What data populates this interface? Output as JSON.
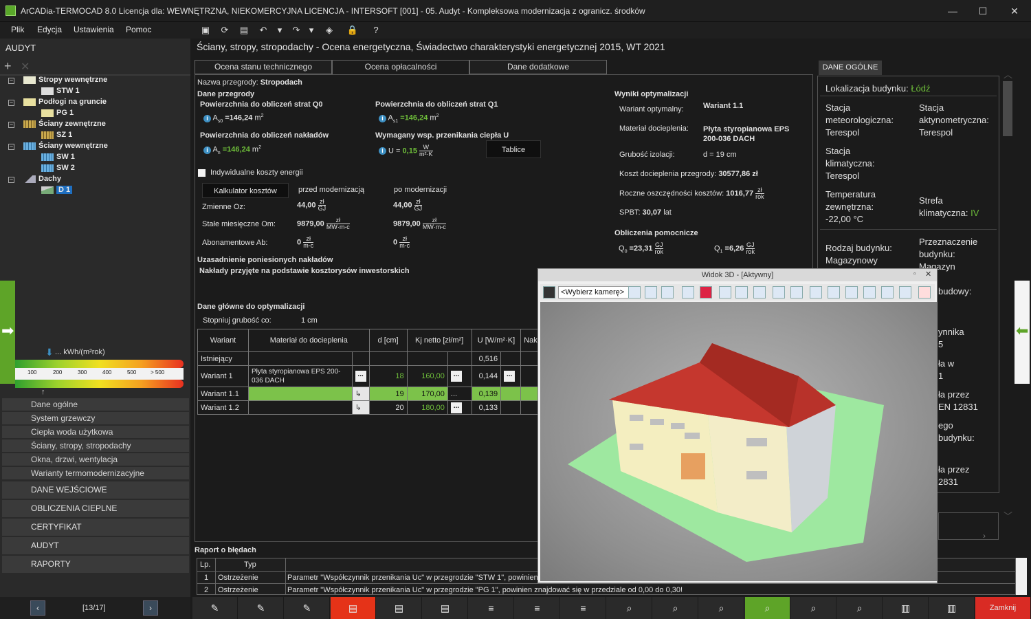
{
  "window": {
    "title": "ArCADia-TERMOCAD 8.0 Licencja dla: WEWNĘTRZNA, NIEKOMERCYJNA LICENCJA - INTERSOFT [001] - 05. Audyt - Kompleksowa modernizacja z ogranicz. środków"
  },
  "menu": [
    "Plik",
    "Edycja",
    "Ustawienia",
    "Pomoc"
  ],
  "left": {
    "title": "AUDYT",
    "tree": [
      {
        "label": "Stropy wewnętrzne",
        "child": "STW 1"
      },
      {
        "label": "Podłogi na gruncie",
        "child": "PG 1"
      },
      {
        "label": "Ściany zewnętrzne",
        "child": "SZ 1"
      },
      {
        "label": "Ściany wewnętrzne",
        "child": "SW 1",
        "child2": "SW 2"
      },
      {
        "label": "Dachy",
        "child": "D 1"
      }
    ],
    "energy_label": "... kWh/(m²rok)",
    "scale": [
      "100",
      "200",
      "300",
      "400",
      "500",
      "> 500"
    ],
    "nav": [
      "Dane ogólne",
      "System grzewczy",
      "Ciepła woda użytkowa",
      "Ściany, stropy, stropodachy",
      "Okna, drzwi, wentylacja",
      "Warianty termomodernizacyjne"
    ],
    "bignav": [
      "DANE WEJŚCIOWE",
      "OBLICZENIA CIEPLNE",
      "CERTYFIKAT",
      "AUDYT",
      "RAPORTY"
    ],
    "pager": "[13/17]"
  },
  "header": {
    "title": "Ściany, stropy, stropodachy - Ocena energetyczna, Świadectwo charakterystyki energetycznej 2015, WT 2021"
  },
  "tabs": [
    "Ocena stanu technicznego",
    "Ocena opłacalności",
    "Dane dodatkowe"
  ],
  "form": {
    "name_label": "Nazwa przegrody:",
    "name_value": "Stropodach",
    "section_data": "Dane przegrody",
    "q0_label": "Powierzchnia do obliczeń strat Q0",
    "q0_value": "=146,24",
    "q1_label": "Powierzchnia do obliczeń strat Q1",
    "q1_value": "=146,24",
    "n_label": "Powierzchnia do obliczeń nakładów",
    "n_value": "=146,24",
    "u_label": "Wymagany wsp. przenikania ciepła U",
    "u_value": "0,15",
    "tablice": "Tablice",
    "individual": "Indywidualne koszty energii",
    "calc_btn": "Kalkulator kosztów",
    "before": "przed modernizacją",
    "after": "po modernizacji",
    "oz_label": "Zmienne Oz:",
    "oz_before": "44,00",
    "oz_after": "44,00",
    "om_label": "Stałe miesięczne Om:",
    "om_before": "9879,00",
    "om_after": "9879,00",
    "ab_label": "Abonamentowe Ab:",
    "ab_before": "0",
    "ab_after": "0",
    "justif_label": "Uzasadnienie poniesionych nakładów",
    "justif_value": "Nakłady przyjęte na podstawie kosztorysów inwestorskich",
    "opt_label": "Dane główne do optymalizacji",
    "step_label": "Stopniuj grubość co:",
    "step_value": "1 cm"
  },
  "table": {
    "headers": [
      "Wariant",
      "Materiał do docieplenia",
      "d [cm]",
      "Kj netto [zł/m²]",
      "U [W/m²·K]",
      "Nakłady"
    ],
    "rows": [
      {
        "name": "Istniejący",
        "material": "",
        "d": "",
        "kj": "",
        "u": "0,516"
      },
      {
        "name": "Wariant 1",
        "material": "Płyta styropianowa EPS 200-036 DACH",
        "d": "18",
        "kj": "160,00",
        "u": "0,144"
      },
      {
        "name": "Wariant 1.1",
        "material": "",
        "d": "19",
        "kj": "170,00",
        "u": "0,139"
      },
      {
        "name": "Wariant 1.2",
        "material": "",
        "d": "20",
        "kj": "180,00",
        "u": "0,133"
      }
    ]
  },
  "results": {
    "title": "Wyniki optymalizacji",
    "opt_label": "Wariant optymalny:",
    "opt_value": "Wariant 1.1",
    "mat_label": "Materiał docieplenia:",
    "mat_value": "Płyta styropianowa EPS 200-036 DACH",
    "thick_label": "Grubość izolacji:",
    "thick_value": "d = 19 cm",
    "cost_label": "Koszt docieplenia przegrody:",
    "cost_value": "30577,86 zł",
    "savings_label": "Roczne oszczędności kosztów:",
    "savings_value": "1016,77",
    "spbt_label": "SPBT:",
    "spbt_value": "30,07",
    "spbt_unit": "lat",
    "aux_title": "Obliczenia pomocnicze",
    "q0": "=23,31",
    "q1": "=6,26"
  },
  "right": {
    "tab": "DANE OGÓLNE",
    "location_label": "Lokalizacja budynku:",
    "location_value": "Łódź",
    "met_label": "Stacja meteorologiczna:",
    "met_value": "Terespol",
    "act_label": "Stacja aktynometryczna:",
    "act_value": "Terespol",
    "clim_label": "Stacja klimatyczna:",
    "clim_value": "Terespol",
    "temp_label": "Temperatura zewnętrzna:",
    "temp_value": "-22,00 °C",
    "zone_label": "Strefa klimatyczna:",
    "zone_value": "IV",
    "type_label": "Rodzaj budynku:",
    "type_value": "Magazynowy",
    "purpose_label": "Przeznaczenie budynku:",
    "purpose_value": "Magazyn",
    "partial": [
      "budowy:",
      "ynnika",
      "5",
      "ła w",
      "1",
      "ła przez",
      "EN 12831",
      "ego",
      "budynku:",
      "ła przez",
      "2831"
    ]
  },
  "popup": {
    "title": "Widok 3D - [Aktywny]",
    "camera": "<Wybierz kamerę>"
  },
  "errors": {
    "title": "Raport o błędach",
    "headers": [
      "Lp.",
      "Typ"
    ],
    "rows": [
      {
        "lp": "1",
        "type": "Ostrzeżenie",
        "msg": "Parametr \"Współczynnik przenikania Uc\" w przegrodzie \"STW 1\", powinien zn"
      },
      {
        "lp": "2",
        "type": "Ostrzeżenie",
        "msg": "Parametr \"Współczynnik przenikania Uc\" w przegrodzie \"PG 1\", powinien znajdować się w przedziale od 0,00 do 0,30!"
      }
    ]
  },
  "bottom": {
    "close": "Zamknij"
  }
}
